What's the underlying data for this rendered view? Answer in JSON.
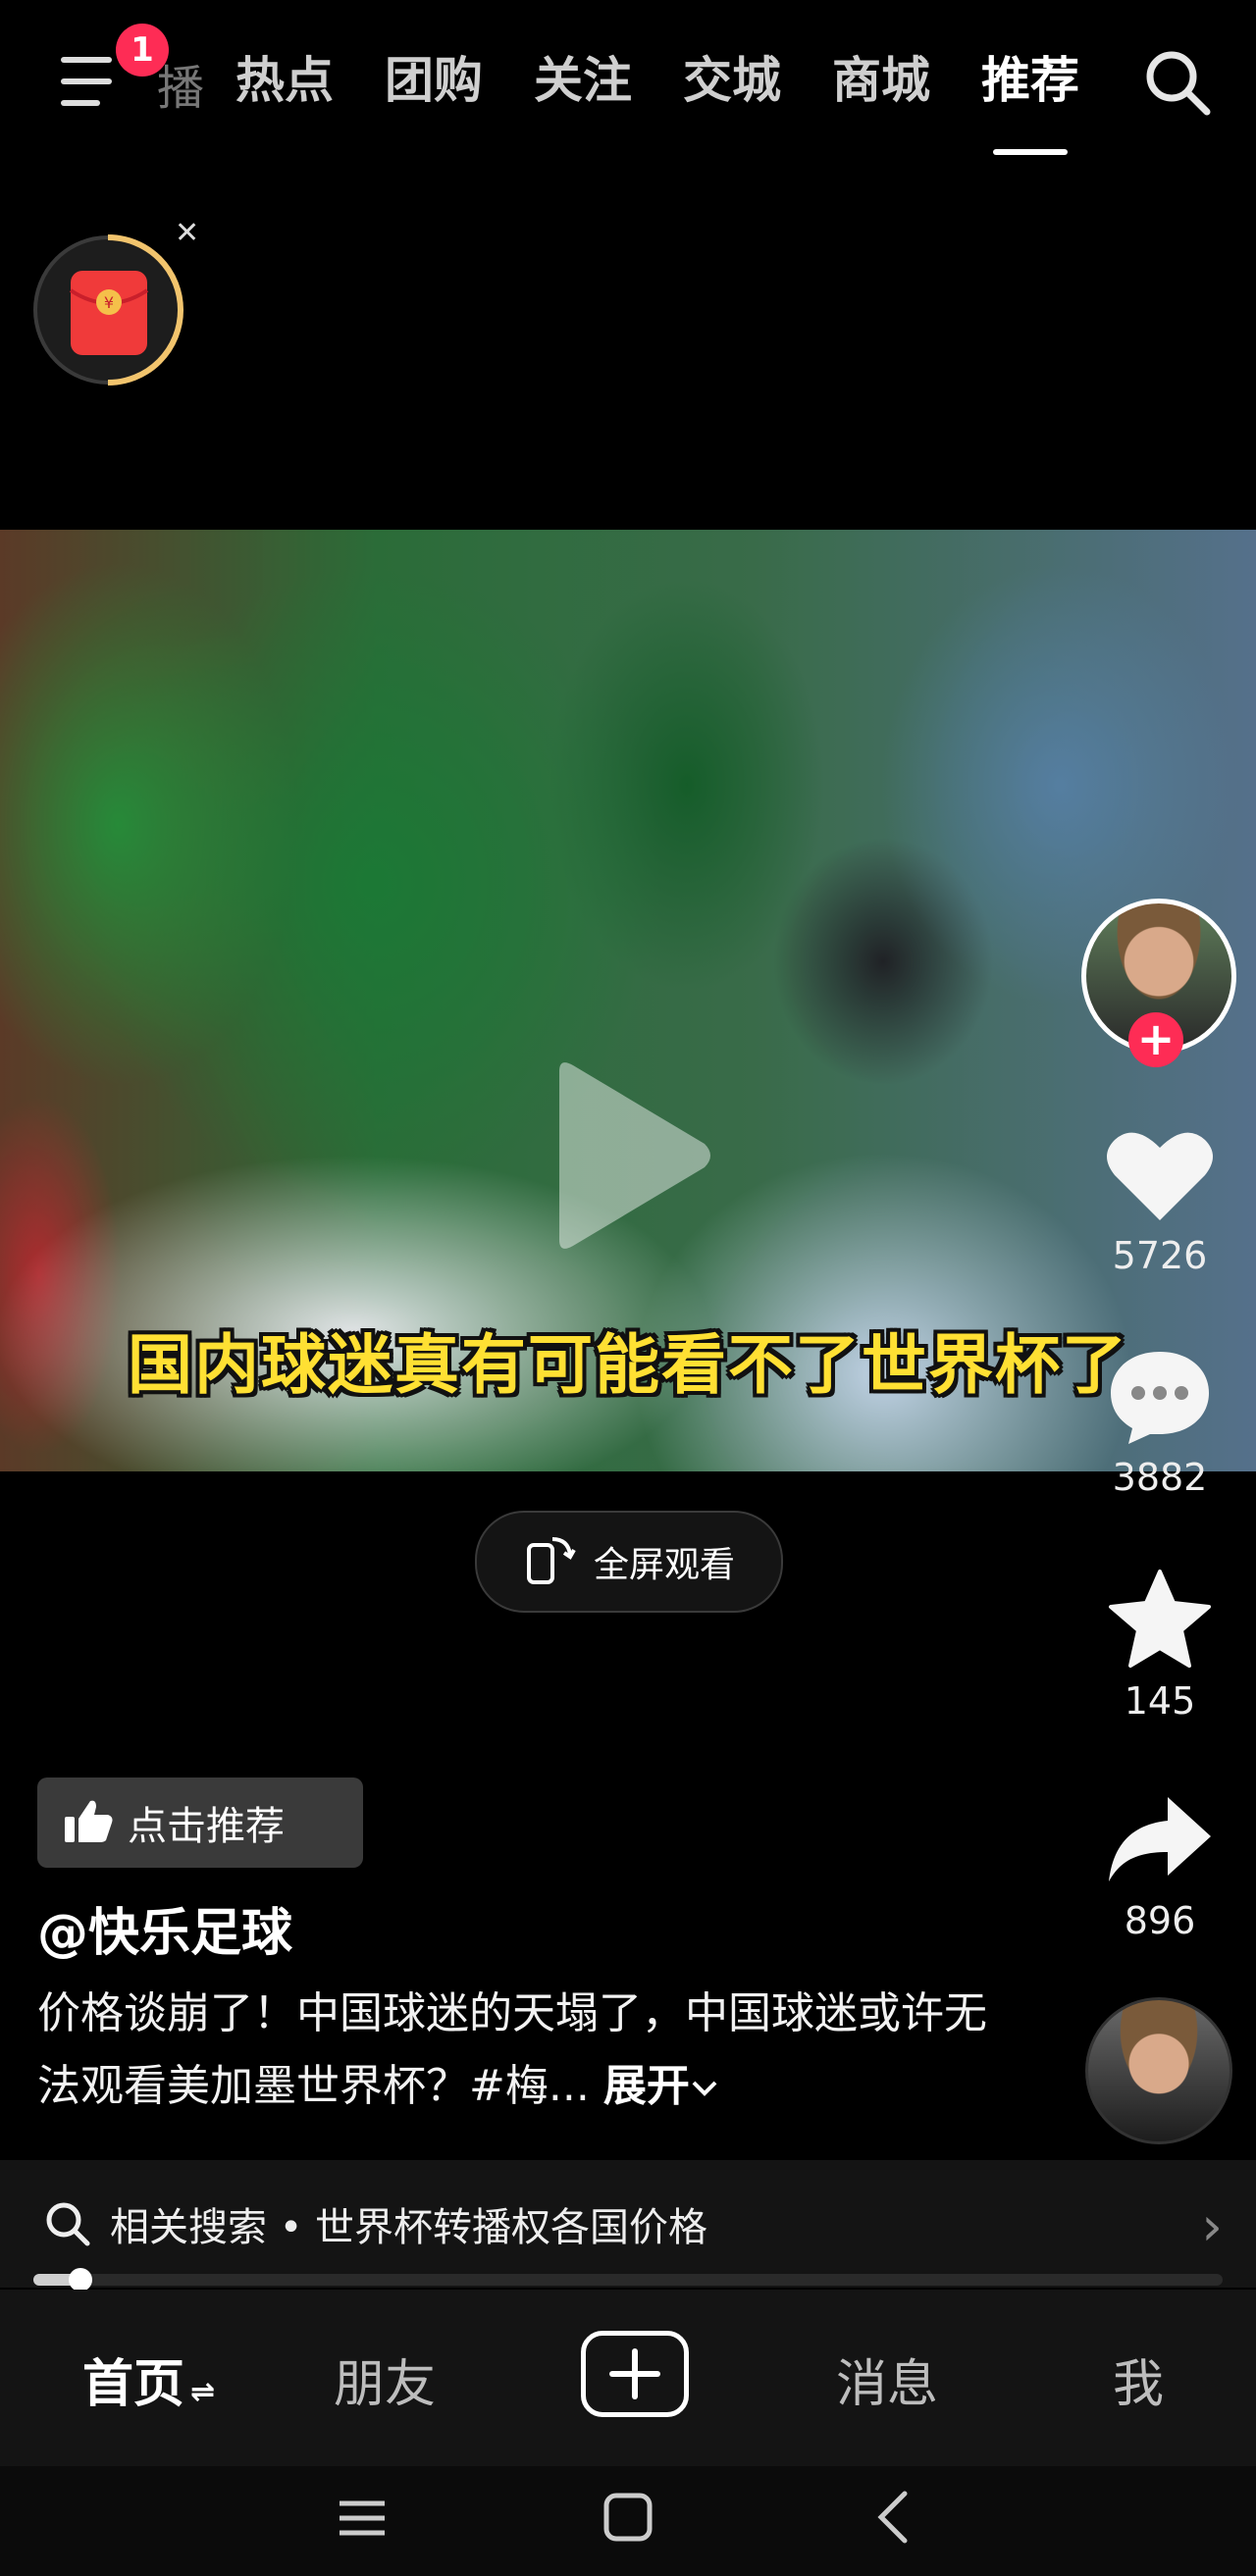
{
  "top_bar": {
    "notification_count": "1",
    "live_fragment": "播",
    "tabs": [
      {
        "label": "热点"
      },
      {
        "label": "团购"
      },
      {
        "label": "关注"
      },
      {
        "label": "交城"
      },
      {
        "label": "商城"
      },
      {
        "label": "推荐",
        "active": true
      }
    ]
  },
  "video": {
    "caption": "国内球迷真有可能看不了世界杯了",
    "fullscreen_label": "全屏观看"
  },
  "actions": {
    "likes": "5726",
    "comments": "3882",
    "favorites": "145",
    "shares": "896"
  },
  "info": {
    "recommend_label": "点击推荐",
    "author": "@快乐足球",
    "description": "价格谈崩了！中国球迷的天塌了，中国球迷或许无法观看美加墨世界杯？#梅...",
    "expand_label": "展开"
  },
  "related_search": {
    "text": "相关搜索 • 世界杯转播权各国价格"
  },
  "playback": {
    "progress_fraction": 0.04
  },
  "bottom_nav": {
    "items": [
      {
        "label": "首页",
        "active": true
      },
      {
        "label": "朋友"
      },
      {
        "label": "消息"
      },
      {
        "label": "我"
      }
    ]
  },
  "colors": {
    "accent": "#fe2c55",
    "caption_yellow": "#ffe033",
    "background": "#000000"
  }
}
